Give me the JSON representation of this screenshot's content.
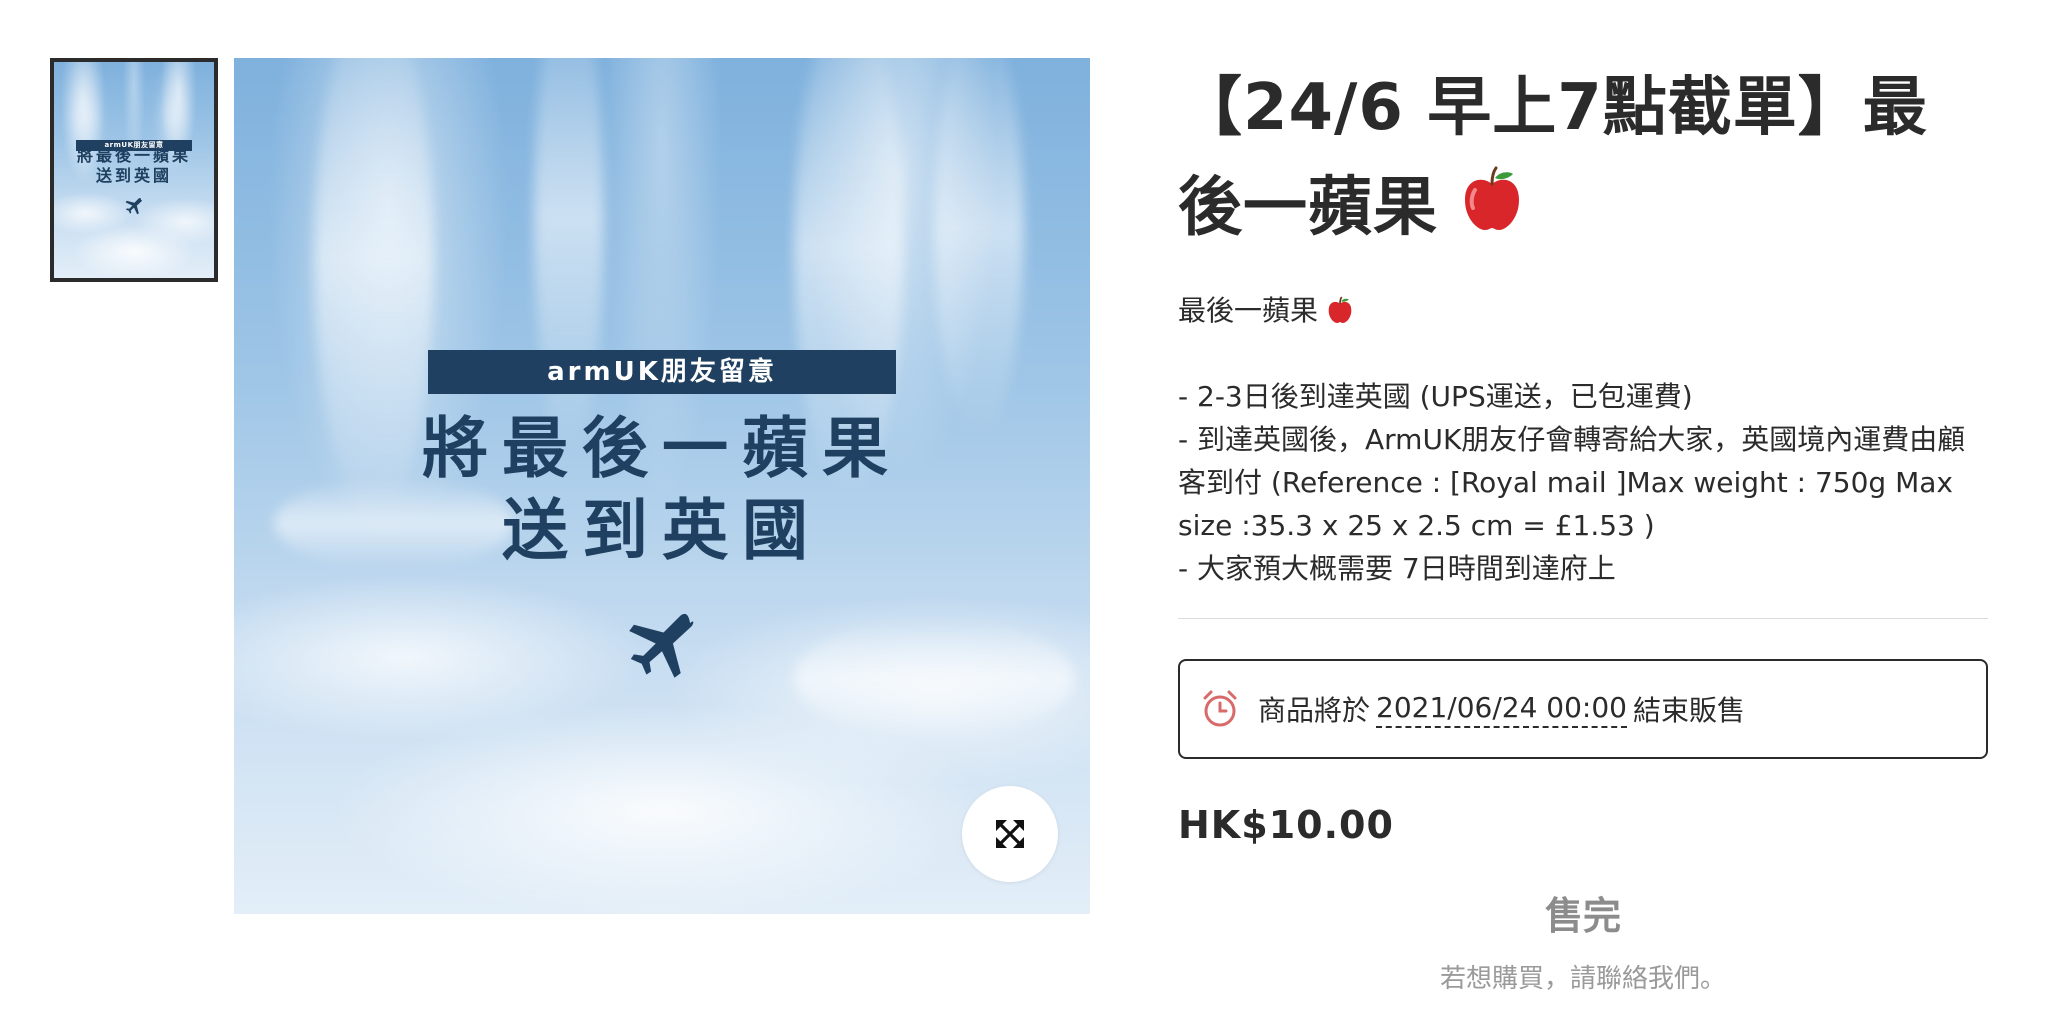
{
  "product": {
    "title_line1": "【24/6 早上7點截單】最",
    "title_line2": "後一蘋果",
    "title_emoji": "🍎",
    "image_banner": "armUK朋友留意",
    "image_headline_1": "將最後一蘋果",
    "image_headline_2": "送到英國",
    "description": {
      "intro": "最後一蘋果",
      "intro_emoji": "🍎",
      "lines": [
        "- 2-3日後到達英國 (UPS運送，已包運費)",
        "- 到達英國後，ArmUK朋友仔會轉寄給大家，英國境內運費由顧",
        "客到付 (Reference : [Royal mail ]Max weight : 750g Max",
        "size :35.3 x 25 x 2.5 cm = £1.53 )",
        "- 大家預大概需要 7日時間到達府上"
      ]
    },
    "countdown": {
      "prefix": "商品將於",
      "date": "2021/06/24 00:00",
      "suffix": "結束販售"
    },
    "price": "HK$10.00",
    "status": "售完",
    "contact_note": "若想購買，請聯絡我們。"
  },
  "colors": {
    "banner": "#1f4060",
    "clock_icon": "#d86a6a",
    "text": "#2b2b2b",
    "muted": "#8c8c8c"
  },
  "icons": {
    "zoom": "expand-arrows-icon",
    "clock": "alarm-clock-icon",
    "plane": "airplane-icon"
  }
}
